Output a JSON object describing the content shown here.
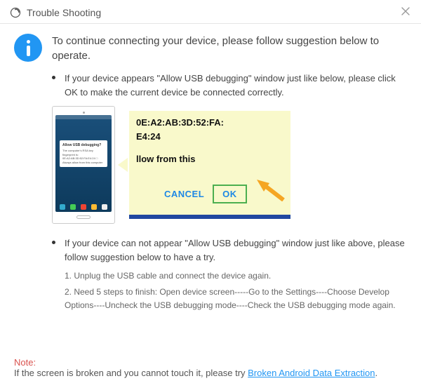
{
  "titlebar": {
    "title": "Trouble Shooting"
  },
  "headline": "To continue connecting your device, please follow suggestion below to operate.",
  "item1": {
    "text": "If your device appears \"Allow USB debugging\" window just like below, please click OK to make the current device  be connected correctly."
  },
  "illustration": {
    "phone_dialog_title": "Allow USB debugging?",
    "phone_dialog_body": "The computer's RSA key fingerprint is:\n0E:A2:AB:3D:52:FA:E4:24\n□ Always allow from this computer",
    "zoom_line1": "0E:A2:AB:3D:52:FA:",
    "zoom_line2": "E4:24",
    "zoom_line3": "llow from this",
    "cancel": "CANCEL",
    "ok": "OK"
  },
  "item2": {
    "text": "If your device can not appear \"Allow USB debugging\" window just like above, please follow suggestion below to have a try.",
    "step1": "1. Unplug the USB cable and connect the device again.",
    "step2": "2. Need 5 steps to finish: Open device screen-----Go to the Settings----Choose Develop Options----Uncheck the USB debugging mode----Check the USB debugging mode again."
  },
  "footer": {
    "note_label": "Note:",
    "note_text": "If the screen is broken and you cannot touch it, please try ",
    "note_link": "Broken Android Data Extraction",
    "note_period": "."
  }
}
